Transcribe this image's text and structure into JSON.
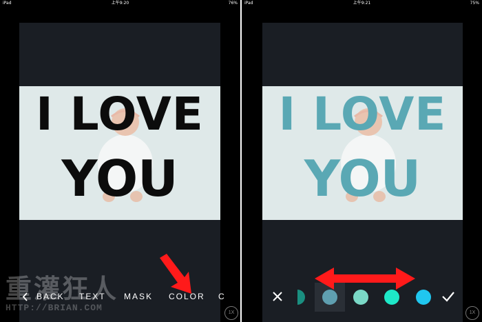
{
  "status_left": {
    "device": "iPad",
    "time": "上午9:20",
    "battery": "76%"
  },
  "status_right": {
    "device": "iPad",
    "time": "上午9:21",
    "battery": "75%"
  },
  "poster": {
    "line1": "I LOVE",
    "line2": "YOU"
  },
  "toolbar": {
    "back": "BACK",
    "text": "TEXT",
    "mask": "MASK",
    "color": "COLOR",
    "more": "C"
  },
  "zoom_label": "1X",
  "watermark": {
    "title": "重灌狂人",
    "url": "HTTP://BRIAN.COM"
  },
  "colors": {
    "canvas_bg": "#1a1e24",
    "photo_bg": "#dfe9e9",
    "text_left": "#0c0c0c",
    "text_right": "#5aa8b4",
    "callout_red": "#ff1a1a",
    "swatches": [
      "#1a8f80",
      "#5f9fb0",
      "#7ad8c6",
      "#1ee8c8",
      "#20c7ef"
    ]
  },
  "icons": [
    "back-chevron-icon",
    "close-icon",
    "check-icon",
    "red-arrow-icon",
    "double-arrow-icon"
  ]
}
